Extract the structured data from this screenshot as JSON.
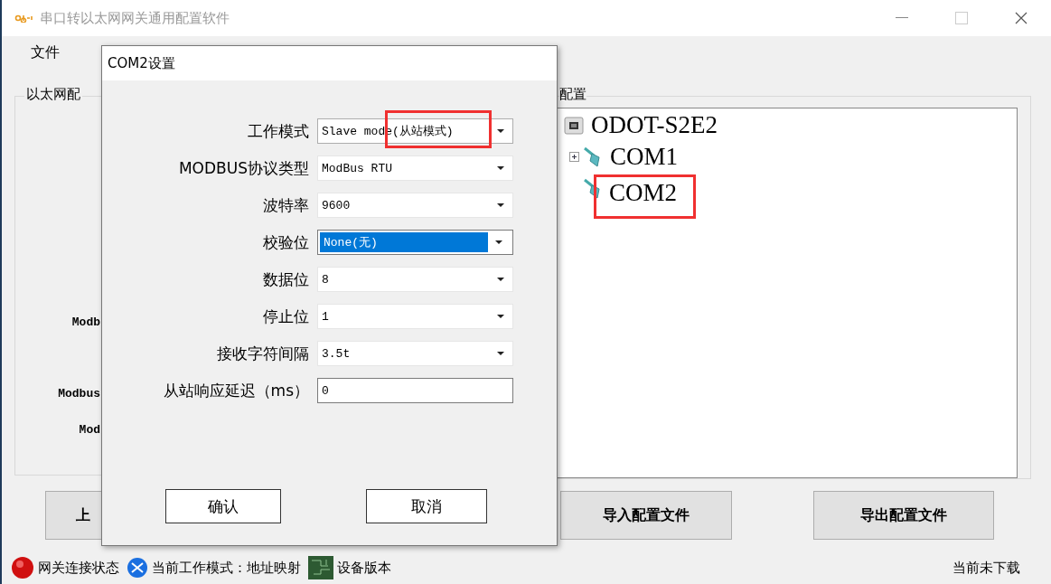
{
  "window": {
    "title": "串口转以太网网关通用配置软件"
  },
  "menu": [
    "文件"
  ],
  "ethernet_group": {
    "title": "以太网配",
    "labels": [
      "Modb",
      "Modbus",
      "Mod"
    ]
  },
  "upload_button": "上",
  "serial_group": {
    "title": "配置",
    "tree": {
      "label": "ODOT-S2E2",
      "children": [
        {
          "label": "COM1",
          "expanded": false
        },
        {
          "label": "COM2",
          "highlighted": true
        }
      ]
    }
  },
  "buttons": [
    "导入配置文件",
    "导出配置文件"
  ],
  "status_bar": {
    "items": [
      {
        "kind": "led",
        "text": "网关连接状态"
      },
      {
        "kind": "mode",
        "text": "当前工作模式：地址映射"
      },
      {
        "kind": "board",
        "text": "设备版本"
      }
    ],
    "right": "当前未下载"
  },
  "dialog": {
    "title": "COM2设置",
    "fields": [
      {
        "label": "工作模式",
        "value": "Slave mode(从站模式)",
        "kind": "select",
        "focused": false,
        "highlighted": true
      },
      {
        "label": "MODBUS协议类型",
        "value": "ModBus RTU",
        "kind": "select",
        "focused": false
      },
      {
        "label": "波特率",
        "value": "9600",
        "kind": "select",
        "focused": false
      },
      {
        "label": "校验位",
        "value": "None(无)",
        "kind": "select",
        "focused": true
      },
      {
        "label": "数据位",
        "value": "8",
        "kind": "select",
        "focused": false
      },
      {
        "label": "停止位",
        "value": "1",
        "kind": "select",
        "focused": false
      },
      {
        "label": "接收字符间隔",
        "value": "3.5t",
        "kind": "select",
        "focused": false
      },
      {
        "label": "从站响应延迟（ms）",
        "value": "0",
        "kind": "input"
      }
    ],
    "buttons": [
      "确认",
      "取消"
    ]
  }
}
